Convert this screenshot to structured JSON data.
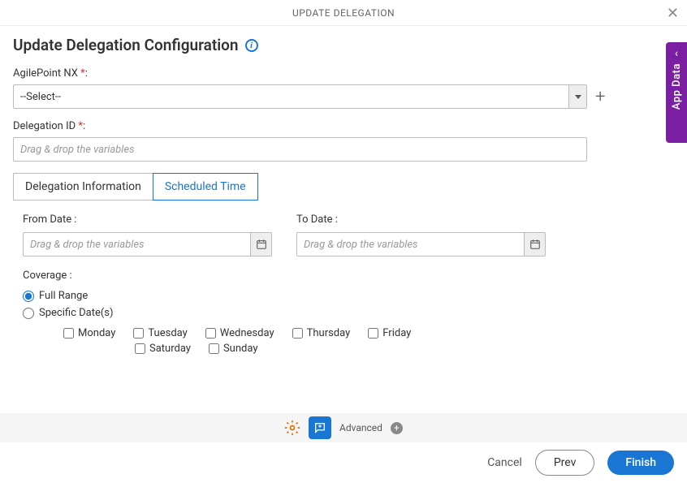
{
  "header": {
    "title": "UPDATE DELEGATION"
  },
  "page": {
    "title": "Update Delegation Configuration"
  },
  "fields": {
    "agilepoint": {
      "label": "AgilePoint NX ",
      "required": "*",
      "colon": ":",
      "value": "--Select--"
    },
    "delegationId": {
      "label": "Delegation ID ",
      "required": "*",
      "colon": ":",
      "placeholder": "Drag & drop the variables"
    }
  },
  "tabs": {
    "info": "Delegation Information",
    "scheduled": "Scheduled Time"
  },
  "dates": {
    "fromLabel": "From Date :",
    "toLabel": "To Date :",
    "placeholder": "Drag & drop the variables"
  },
  "coverage": {
    "label": "Coverage  :",
    "full": "Full Range",
    "specific": "Specific Date(s)",
    "days": {
      "mon": "Monday",
      "tue": "Tuesday",
      "wed": "Wednesday",
      "thu": "Thursday",
      "fri": "Friday",
      "sat": "Saturday",
      "sun": "Sunday"
    }
  },
  "footer": {
    "advanced": "Advanced"
  },
  "actions": {
    "cancel": "Cancel",
    "prev": "Prev",
    "finish": "Finish"
  },
  "side": {
    "label": "App Data"
  }
}
